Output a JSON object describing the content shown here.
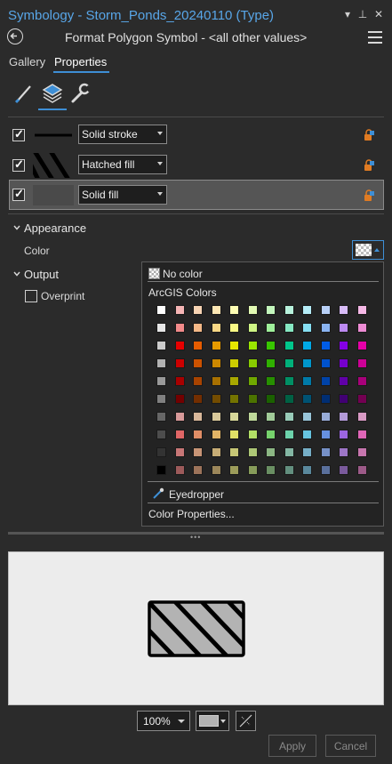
{
  "window": {
    "title": "Symbology - Storm_Ponds_20240110 (Type)",
    "controls": {
      "menu": "▾",
      "pin": "⊥",
      "close": "✕"
    }
  },
  "header": {
    "title": "Format Polygon Symbol - <all other values>"
  },
  "tabs": [
    {
      "label": "Gallery",
      "active": false
    },
    {
      "label": "Properties",
      "active": true
    }
  ],
  "icon_tabs": [
    {
      "name": "properties-icon",
      "active": false
    },
    {
      "name": "layers-icon",
      "active": true
    },
    {
      "name": "structure-icon",
      "active": false
    }
  ],
  "layers": [
    {
      "type": "Solid stroke",
      "checked": true,
      "selected": false
    },
    {
      "type": "Hatched fill",
      "checked": true,
      "selected": false
    },
    {
      "type": "Solid fill",
      "checked": true,
      "selected": true
    }
  ],
  "appearance": {
    "title": "Appearance",
    "color_label": "Color"
  },
  "output": {
    "title": "Output",
    "overprint_label": "Overprint",
    "overprint_checked": false
  },
  "color_popup": {
    "no_color": "No color",
    "palette_name": "ArcGIS Colors",
    "eyedropper": "Eyedropper",
    "color_properties": "Color Properties...",
    "palette": [
      [
        "#ffffff",
        "#f5b5b5",
        "#f7d3b3",
        "#fce6b3",
        "#fdfdb3",
        "#e2f9b3",
        "#c3f6bc",
        "#b8f2dc",
        "#b5ecf7",
        "#b8d0f7",
        "#d7bbf7",
        "#f5b8e6"
      ],
      [
        "#e6e6e6",
        "#f28a8a",
        "#f4b887",
        "#f8d785",
        "#f9f985",
        "#cff585",
        "#9ff09a",
        "#86e8c2",
        "#86def2",
        "#8ab4f2",
        "#bc8af2",
        "#ee8cd4"
      ],
      [
        "#cccccc",
        "#e60000",
        "#e65c00",
        "#e69b00",
        "#e6e600",
        "#9be600",
        "#38c600",
        "#00c68b",
        "#00a9e6",
        "#005ce6",
        "#8400e6",
        "#e600a9"
      ],
      [
        "#b2b2b2",
        "#cc0000",
        "#cc5200",
        "#cc8800",
        "#cccc00",
        "#88cc00",
        "#30b000",
        "#00b07a",
        "#0096cc",
        "#0052cc",
        "#7500cc",
        "#cc0096"
      ],
      [
        "#999999",
        "#a80000",
        "#a84300",
        "#a87000",
        "#a8a800",
        "#70a800",
        "#278f00",
        "#008f64",
        "#007aa8",
        "#0043a8",
        "#6000a8",
        "#a8007a"
      ],
      [
        "#808080",
        "#730000",
        "#732e00",
        "#734c00",
        "#737300",
        "#4c7300",
        "#1b6100",
        "#006144",
        "#005273",
        "#002e73",
        "#410073",
        "#730052"
      ],
      [
        "#666666",
        "#d89a9a",
        "#d8b79a",
        "#d8c89a",
        "#d8d89a",
        "#bfd89a",
        "#a1cb98",
        "#98cbb8",
        "#98c4d8",
        "#98acd8",
        "#b29ad8",
        "#d89ac4"
      ],
      [
        "#4d4d4d",
        "#e06666",
        "#e08d66",
        "#e0b366",
        "#e0e066",
        "#b3e066",
        "#76d26c",
        "#6cd2ab",
        "#66c4e0",
        "#6690e0",
        "#9c66e0",
        "#e066b8"
      ],
      [
        "#333333",
        "#c77676",
        "#c79476",
        "#c7ad76",
        "#c7c776",
        "#adc776",
        "#8cb784",
        "#84b7a4",
        "#76aec7",
        "#7690c7",
        "#9d76c7",
        "#c776ae"
      ],
      [
        "#000000",
        "#9c5a5a",
        "#9c735a",
        "#9c875a",
        "#9c9c5a",
        "#879c5a",
        "#6a8f63",
        "#638f7f",
        "#5a889c",
        "#5a709c",
        "#7a5a9c",
        "#9c5a88"
      ]
    ]
  },
  "bottom": {
    "zoom": "100%",
    "apply": "Apply",
    "cancel": "Cancel"
  },
  "colors": {
    "accent": "#3e8fd6",
    "background": "#2b2b2b",
    "preview_fill": "#b3b3b3",
    "preview_stroke": "#000000"
  }
}
